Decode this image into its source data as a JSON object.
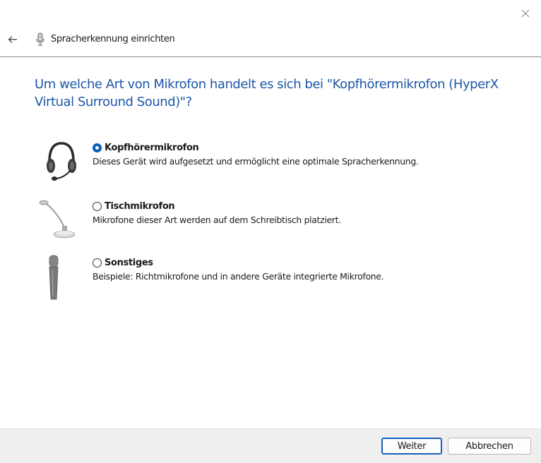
{
  "window": {
    "title": "Spracherkennung einrichten",
    "close_icon": "close-icon",
    "back_icon": "back-arrow-icon"
  },
  "question": "Um welche Art von Mikrofon handelt es sich bei \"Kopfhörermikrofon (HyperX Virtual Surround Sound)\"?",
  "options": [
    {
      "label": "Kopfhörermikrofon",
      "description": "Dieses Gerät wird aufgesetzt und ermöglicht eine optimale Spracherkennung.",
      "selected": true,
      "icon": "headset-microphone-icon"
    },
    {
      "label": "Tischmikrofon",
      "description": "Mikrofone dieser Art werden auf dem Schreibtisch platziert.",
      "selected": false,
      "icon": "desktop-microphone-icon"
    },
    {
      "label": "Sonstiges",
      "description": "Beispiele: Richtmikrofone und in andere Geräte integrierte Mikrofone.",
      "selected": false,
      "icon": "handheld-microphone-icon"
    }
  ],
  "buttons": {
    "next": "Weiter",
    "cancel": "Abbrechen"
  },
  "colors": {
    "heading": "#1e57a8",
    "radio_selected": "#0a5fb4",
    "footer_bg": "#efefef"
  }
}
